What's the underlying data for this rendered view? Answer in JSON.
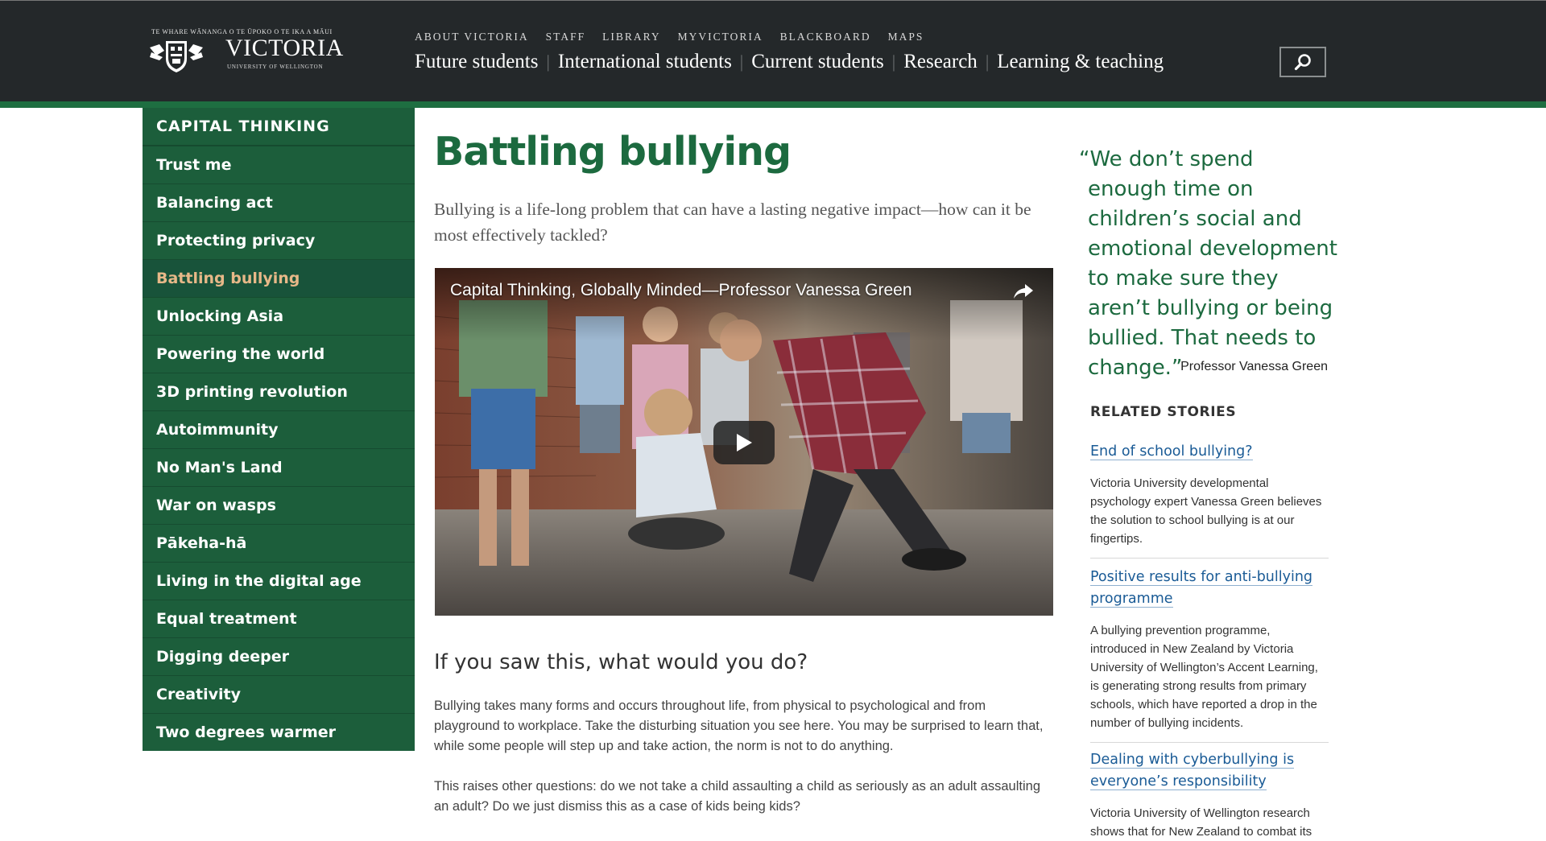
{
  "header": {
    "logo": {
      "motto": "TE WHARE WĀNANGA O TE ŪPOKO O TE IKA A MĀUI",
      "name": "VICTORIA",
      "sub": "UNIVERSITY OF WELLINGTON"
    },
    "utility_nav": [
      "ABOUT VICTORIA",
      "STAFF",
      "LIBRARY",
      "MYVICTORIA",
      "BLACKBOARD",
      "MAPS"
    ],
    "main_nav": [
      "Future students",
      "International students",
      "Current students",
      "Research",
      "Learning & teaching"
    ],
    "search_icon": "search-icon"
  },
  "sidebar": {
    "heading": "CAPITAL THINKING",
    "items": [
      "Trust me",
      "Balancing act",
      "Protecting privacy",
      "Battling bullying",
      "Unlocking Asia",
      "Powering the world",
      "3D printing revolution",
      "Autoimmunity",
      "No Man's Land",
      "War on wasps",
      "Pākeha-hā",
      "Living in the digital age",
      "Equal treatment",
      "Digging deeper",
      "Creativity",
      "Two degrees warmer"
    ],
    "active_item": "Battling bullying"
  },
  "main": {
    "title": "Battling bullying",
    "lead": "Bullying is a life-long problem that can have a lasting negative impact—how can it be most effectively tackled?",
    "video": {
      "title": "Capital Thinking, Globally Minded—Professor Vanessa Green",
      "share_icon": "share-icon",
      "play_icon": "play-icon"
    },
    "section_heading": "If you saw this, what would you do?",
    "paragraphs": [
      "Bullying takes many forms and occurs throughout life, from physical to psychological and from playground to workplace. Take the disturbing situation you see here. You may be surprised to learn that, while some people will step up and take action, the norm is not to do anything.",
      "This raises other questions: do we not take a child assaulting a child as seriously as an adult assaulting an adult? Do we just dismiss this as a case of kids being kids?"
    ]
  },
  "aside": {
    "quote": "“We don’t spend enough time on children’s social and emotional development to make sure they aren’t bullying or being bullied. That needs to change.”",
    "quote_author": "Professor Vanessa Green",
    "related_heading": "RELATED STORIES",
    "stories": [
      {
        "title": "End of school bullying?",
        "summary": "Victoria University developmental psychology expert Vanessa Green believes the solution to school bullying is at our fingertips."
      },
      {
        "title": "Positive results for anti-bullying programme",
        "summary": "A bullying prevention programme, introduced in New Zealand by Victoria University of Wellington’s Accent Learning, is generating strong results from primary schools, which have reported a drop in the number of bullying incidents."
      },
      {
        "title": "Dealing with cyberbullying is everyone’s responsibility",
        "summary": "Victoria University of Wellington research shows that for New Zealand to combat its"
      }
    ]
  },
  "colors": {
    "header_bg": "#24282a",
    "brand_green": "#1c5e3b",
    "title_green": "#1c6a3f",
    "active_sidebar": "#e7b888",
    "link_blue": "#1a5b96"
  }
}
